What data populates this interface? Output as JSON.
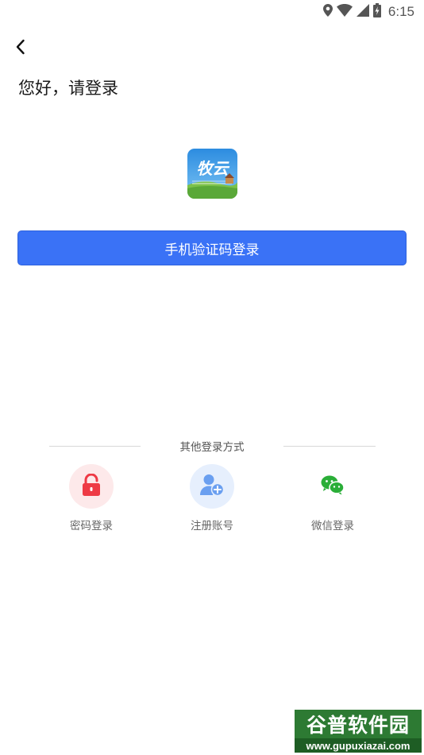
{
  "status_bar": {
    "time": "6:15",
    "icons": [
      "location-icon",
      "wifi-icon",
      "signal-icon",
      "battery-charging-icon"
    ]
  },
  "header": {
    "back_icon": "chevron-left-icon",
    "greeting": "您好，请登录"
  },
  "logo": {
    "text": "牧云"
  },
  "primary_button": {
    "label": "手机验证码登录",
    "color": "#3a72f6"
  },
  "other_methods": {
    "title": "其他登录方式",
    "items": [
      {
        "label": "密码登录",
        "icon": "lock-icon",
        "color": "#ee3a45"
      },
      {
        "label": "注册账号",
        "icon": "add-user-icon",
        "color": "#6a9ff0"
      },
      {
        "label": "微信登录",
        "icon": "wechat-icon",
        "color": "#2aae38"
      }
    ]
  },
  "watermark": {
    "title": "谷普软件园",
    "url": "www.gupuxiazai.com"
  }
}
